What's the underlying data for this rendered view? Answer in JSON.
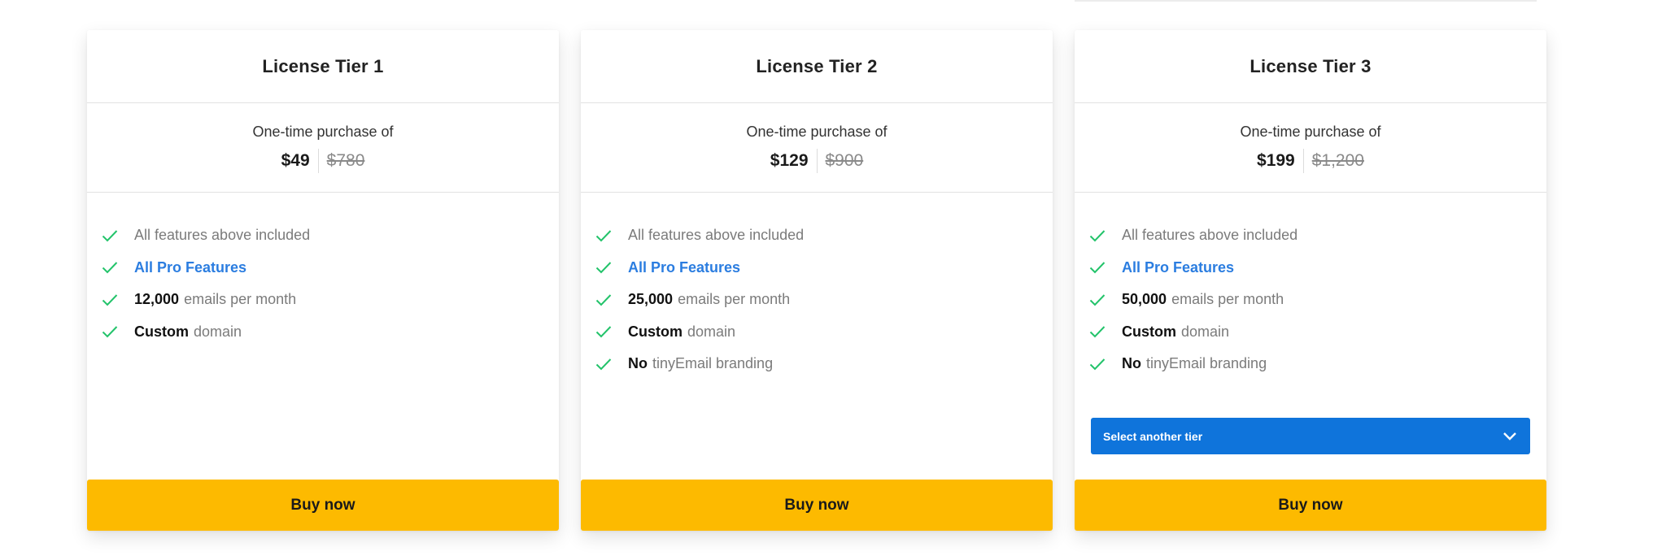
{
  "theme": {
    "accent": "#0f74db",
    "buy": "#fdba00",
    "check": "#22c36a",
    "link": "#2b7de0"
  },
  "tiers": [
    {
      "title": "License Tier 1",
      "caption": "One-time purchase of",
      "price": "$49",
      "was": "$780",
      "features": [
        {
          "bold": "",
          "text": "All features above included"
        },
        {
          "link": "All Pro Features"
        },
        {
          "bold": "12,000",
          "text": "emails per month"
        },
        {
          "bold": "Custom",
          "text": "domain"
        }
      ],
      "buy_label": "Buy now"
    },
    {
      "title": "License Tier 2",
      "caption": "One-time purchase of",
      "price": "$129",
      "was": "$900",
      "features": [
        {
          "bold": "",
          "text": "All features above included"
        },
        {
          "link": "All Pro Features"
        },
        {
          "bold": "25,000",
          "text": "emails per month"
        },
        {
          "bold": "Custom",
          "text": "domain"
        },
        {
          "bold": "No",
          "text": "tinyEmail branding"
        }
      ],
      "buy_label": "Buy now"
    },
    {
      "title": "License Tier 3",
      "caption": "One-time purchase of",
      "price": "$199",
      "was": "$1,200",
      "features": [
        {
          "bold": "",
          "text": "All features above included"
        },
        {
          "link": "All Pro Features"
        },
        {
          "bold": "50,000",
          "text": "emails per month"
        },
        {
          "bold": "Custom",
          "text": "domain"
        },
        {
          "bold": "No",
          "text": "tinyEmail branding"
        }
      ],
      "select_label": "Select another tier",
      "buy_label": "Buy now"
    }
  ]
}
